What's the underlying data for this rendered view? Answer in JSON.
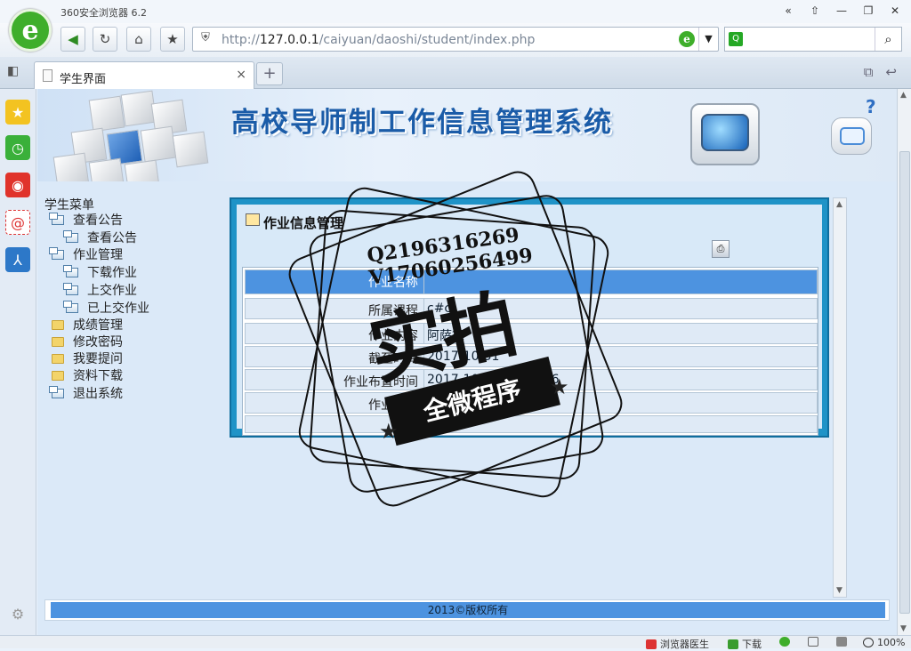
{
  "browser": {
    "app_title": "360安全浏览器 6.2",
    "logo_letter": "e",
    "address_url_prefix": "http://",
    "address_url_host": "127.0.0.1",
    "address_url_path": "/caiyuan/daoshi/student/index.php",
    "search_value": "",
    "tab_label": "学生界面",
    "tab_close": "×",
    "new_tab": "+",
    "window_buttons": [
      "«",
      "⇧",
      "—",
      "❐",
      "✕"
    ]
  },
  "page": {
    "banner_title": "高校导师制工作信息管理系统",
    "banner_question": "?",
    "menu": {
      "title": "学生菜单",
      "items": [
        {
          "label": "查看公告",
          "level": 0,
          "icon": "window-icon"
        },
        {
          "label": "查看公告",
          "level": 1,
          "icon": "window-icon"
        },
        {
          "label": "作业管理",
          "level": 0,
          "icon": "window-icon"
        },
        {
          "label": "下载作业",
          "level": 1,
          "icon": "window-icon"
        },
        {
          "label": "上交作业",
          "level": 1,
          "icon": "window-icon"
        },
        {
          "label": "已上交作业",
          "level": 1,
          "icon": "window-icon"
        },
        {
          "label": "成绩管理",
          "level": 0,
          "icon": "folder-icon"
        },
        {
          "label": "修改密码",
          "level": 0,
          "icon": "folder-icon"
        },
        {
          "label": "我要提问",
          "level": 0,
          "icon": "folder-icon"
        },
        {
          "label": "资料下载",
          "level": 0,
          "icon": "folder-icon"
        },
        {
          "label": "退出系统",
          "level": 0,
          "icon": "window-icon"
        }
      ]
    },
    "panel": {
      "title": "作业信息管理",
      "print_icon": "printer-icon",
      "rows": [
        {
          "label": "作业名称",
          "value": "",
          "head": true
        },
        {
          "label": "所属课程",
          "value": "c#c"
        },
        {
          "label": "作业内容",
          "value": "阿萨德"
        },
        {
          "label": "截至时间",
          "value": "2017-10-31"
        },
        {
          "label": "作业布置时间",
          "value": "2017-10-15 21:52:06"
        },
        {
          "label": "作业下载",
          "value": "点击下载",
          "link": true
        },
        {
          "label": "",
          "value": ""
        }
      ]
    },
    "footer": "2013©版权所有"
  },
  "watermark": {
    "qq": "Q2196316269",
    "v": "V17060256499",
    "big": "实拍",
    "band": "全微程序"
  },
  "statusbar": {
    "items": [
      "浏览器医生",
      "下载",
      "",
      "",
      "",
      "100%"
    ]
  },
  "colors": {
    "accent_blue": "#4d93e0",
    "panel_border": "#1f93c7",
    "brand_green": "#3fae2b",
    "title_blue": "#1b5ca8"
  }
}
